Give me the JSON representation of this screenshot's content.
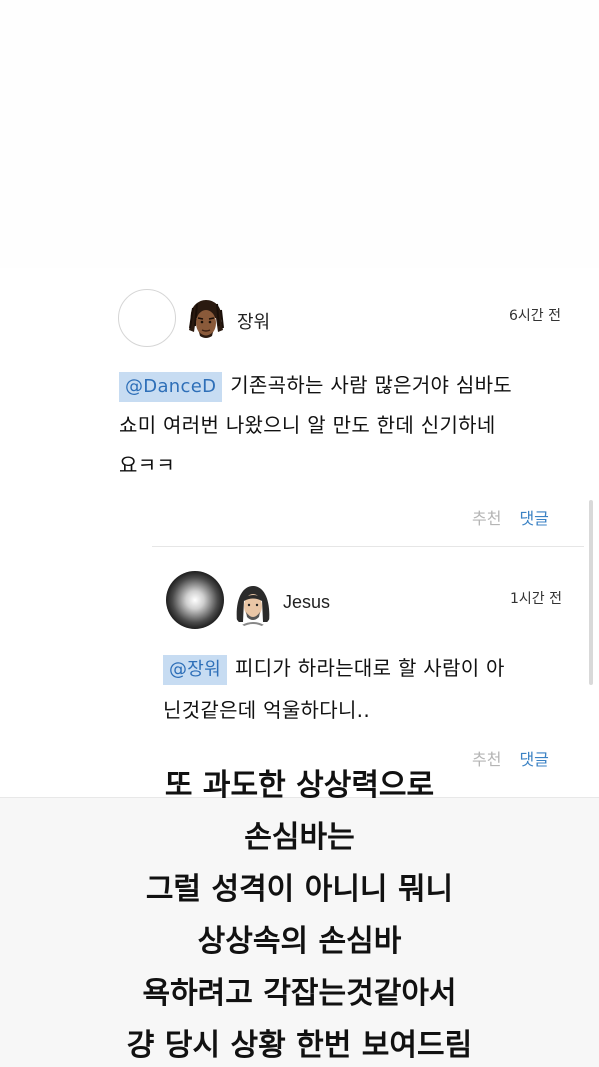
{
  "comments": [
    {
      "author": "장워",
      "time": "6시간 전",
      "mention": "@DanceD",
      "text_line1": "기존곡하는 사람 많은거야 심바도",
      "text_line2": "쇼미 여러번 나왔으니 알 만도 한데 신기하네",
      "text_line3": "요ㅋㅋ",
      "like_label": "추천",
      "reply_label": "댓글"
    },
    {
      "author": "Jesus",
      "time": "1시간 전",
      "mention": "@장워",
      "text_line1": "피디가 하라는대로 할 사람이 아",
      "text_line2": "닌것같은데 억울하다니..",
      "like_label": "추천",
      "reply_label": "댓글"
    }
  ],
  "caption": {
    "lines": [
      "또 과도한 상상력으로",
      "손심바는",
      "그럴 성격이 아니니 뭐니",
      "상상속의 손심바",
      "욕하려고 각잡는것같아서",
      "걍 당시 상황 한번 보여드림"
    ]
  },
  "colors": {
    "mention_bg": "#c7dcf2",
    "mention_text": "#2e6fb8",
    "reply_link": "#3b82c4",
    "like_muted": "#b5b5b5"
  }
}
